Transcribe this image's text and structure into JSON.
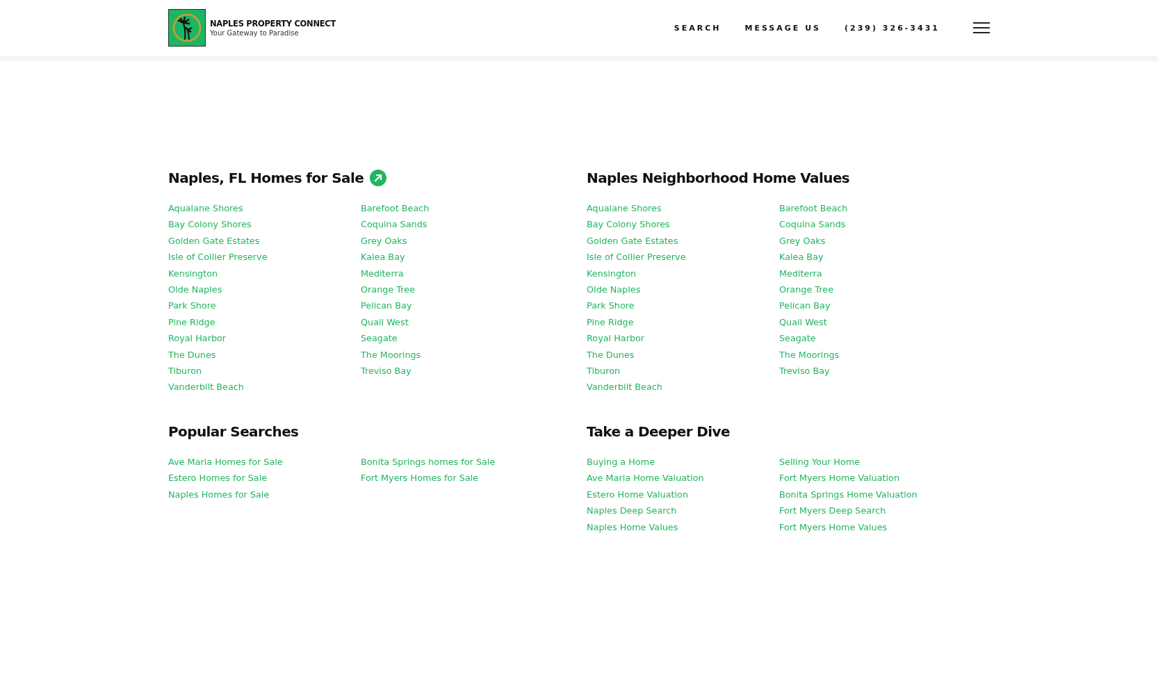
{
  "header": {
    "brand": {
      "name": "NAPLES PROPERTY CONNECT",
      "tagline": "Your Gateway to Paradise"
    },
    "nav": [
      "SEARCH",
      "MESSAGE US",
      "(239) 326-3431"
    ]
  },
  "sections": [
    {
      "title": "Naples, FL Homes for Sale",
      "link_icon": true,
      "columns": [
        [
          "Aqualane Shores",
          "Bay Colony Shores",
          "Golden Gate Estates",
          "Isle of Collier Preserve",
          "Kensington",
          "Olde Naples",
          "Park Shore",
          "Pine Ridge",
          "Royal Harbor",
          "The Dunes",
          "Tiburon",
          "Vanderbilt Beach"
        ],
        [
          "Barefoot Beach",
          "Coquina Sands",
          "Grey Oaks",
          "Kalea Bay",
          "Mediterra",
          "Orange Tree",
          "Pelican Bay",
          "Quail West",
          "Seagate",
          "The Moorings",
          "Treviso Bay"
        ]
      ]
    },
    {
      "title": "Naples Neighborhood Home Values",
      "columns": [
        [
          "Aqualane Shores",
          "Bay Colony Shores",
          "Golden Gate Estates",
          "Isle of Collier Preserve",
          "Kensington",
          "Olde Naples",
          "Park Shore",
          "Pine Ridge",
          "Royal Harbor",
          "The Dunes",
          "Tiburon",
          "Vanderbilt Beach"
        ],
        [
          "Barefoot Beach",
          "Coquina Sands",
          "Grey Oaks",
          "Kalea Bay",
          "Mediterra",
          "Orange Tree",
          "Pelican Bay",
          "Quail West",
          "Seagate",
          "The Moorings",
          "Treviso Bay"
        ]
      ]
    },
    {
      "title": "Popular Searches",
      "columns": [
        [
          "Ave Maria Homes for Sale",
          "Estero Homes for Sale",
          "Naples Homes for Sale"
        ],
        [
          "Bonita Springs homes for Sale",
          "Fort Myers Homes for Sale"
        ]
      ]
    },
    {
      "title": "Take a Deeper Dive",
      "columns": [
        [
          "Buying a Home",
          "Ave Maria Home Valuation",
          "Estero Home Valuation",
          "Naples Deep Search",
          "Naples Home Values"
        ],
        [
          "Selling Your Home",
          "Fort Myers Home Valuation",
          "Bonita Springs Home Valuation",
          "Fort Myers Deep Search",
          "Fort Myers Home Values"
        ]
      ]
    }
  ]
}
